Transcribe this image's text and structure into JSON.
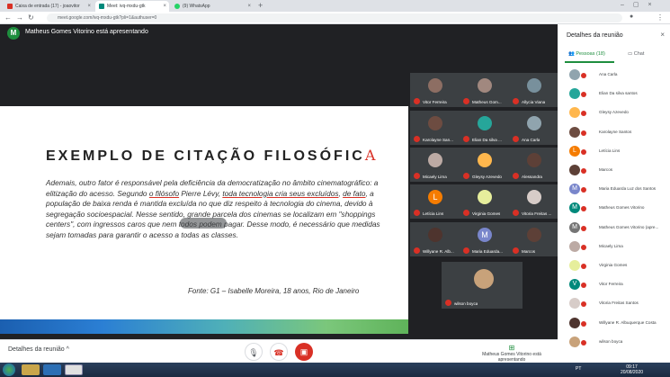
{
  "browser": {
    "tabs": [
      {
        "label": "Caixa de entrada (17) - joaovitor",
        "color": "#d93025"
      },
      {
        "label": "Meet: ivq-mxdu-gtk",
        "color": "#00897b",
        "active": true
      },
      {
        "label": "(9) WhatsApp",
        "color": "#25d366"
      }
    ],
    "url": "meet.google.com/ivq-mxdu-gtk?pli=1&authuser=0"
  },
  "presenter_banner": {
    "avatar": "M",
    "text": "Matheus Gomes Vitorino está apresentando"
  },
  "slide": {
    "title": "EXEMPLO DE CITAÇÃO FILOSÓFIC",
    "title_mark": "A",
    "body_1": "Ademais, outro fator é responsável pela deficiência da democratização no âmbito cinematográfico: a elitização do acesso. Segundo ",
    "body_ul1": "o filósofo",
    "body_2": " Pierre Lévy, ",
    "body_ul2": "toda tecnologia cria seus excluídos",
    "body_3": ", ",
    "body_ul3": "de fato",
    "body_4": ", a população de baixa renda é mantida excluída no que diz respeito à tecnologia do cinema, devido à segregação socioespacial. Nesse sentido, grande parcela dos cinemas se localizam em \"shoppings centers\", com ingressos caros que nem todos podem pagar. Desse modo, é necessário que medidas sejam tomadas para garantir o acesso a todas as classes.",
    "source": "Fonte: G1 – Isabelle Moreira, 18 anos, Rio de Janeiro"
  },
  "tiles": [
    {
      "name": "Vitor Ferreira",
      "color": "#8d6e63"
    },
    {
      "name": "Matheus Gom...",
      "color": "#a1887f"
    },
    {
      "name": "Allycia Viana",
      "color": "#78909c"
    },
    {
      "name": "Karolayne San...",
      "color": "#6d4c41"
    },
    {
      "name": "Elian Da silva ...",
      "color": "#26a69a"
    },
    {
      "name": "Ana Carla",
      "color": "#90a4ae"
    },
    {
      "name": "Micaely Lima",
      "color": "#bcaaa4"
    },
    {
      "name": "Gleysy Azevedo",
      "color": "#ffb74d"
    },
    {
      "name": "Alessandra",
      "color": "#5d4037"
    },
    {
      "name": "Letícia Lins",
      "color": "#f57c00",
      "letter": "L"
    },
    {
      "name": "Virginia Gomes",
      "color": "#e6ee9c"
    },
    {
      "name": "Vitoria Freitas ...",
      "color": "#d7ccc8"
    },
    {
      "name": "Willyane R. Alb...",
      "color": "#4e342e"
    },
    {
      "name": "Maria Eduarda...",
      "color": "#7986cb",
      "letter": "M"
    },
    {
      "name": "Marcos",
      "color": "#5d4037"
    },
    {
      "name": "wilson boyca",
      "color": "#c8a27a"
    }
  ],
  "bottom": {
    "details_label": "Detalhes da reunião",
    "chevron": "^",
    "present_info": "Matheus Gomes Vitorino está apresentando"
  },
  "sidepanel": {
    "title": "Detalhes da reunião",
    "close": "×",
    "tab_people": "Pessoas (18)",
    "tab_chat": "Chat",
    "people": [
      {
        "name": "Ana Carla",
        "color": "#90a4ae"
      },
      {
        "name": "Elian Da silva santos",
        "color": "#26a69a"
      },
      {
        "name": "Gleysy Azevedo",
        "color": "#ffb74d"
      },
      {
        "name": "Karolayne Santos",
        "color": "#6d4c41"
      },
      {
        "name": "Letícia Lins",
        "color": "#f57c00",
        "letter": "L"
      },
      {
        "name": "Marcos",
        "color": "#5d4037"
      },
      {
        "name": "Maria Eduarda Luz dos Santos",
        "color": "#7986cb",
        "letter": "M"
      },
      {
        "name": "Matheus Gomes Vitorino",
        "color": "#00897b",
        "letter": "M"
      },
      {
        "name": "Matheus Gomes Vitorino (apre...",
        "color": "#757575",
        "letter": "M"
      },
      {
        "name": "Micaely Lima",
        "color": "#bcaaa4"
      },
      {
        "name": "Virginia Gomes",
        "color": "#e6ee9c"
      },
      {
        "name": "Vitor Ferreira",
        "color": "#00897b",
        "letter": "V"
      },
      {
        "name": "Vitoria Freitas Santos",
        "color": "#d7ccc8"
      },
      {
        "name": "Willyane R. Albuquerque Costa",
        "color": "#4e342e"
      },
      {
        "name": "wilson boyca",
        "color": "#c8a27a"
      }
    ]
  },
  "taskbar": {
    "lang": "PT",
    "time": "09:17",
    "date": "20/08/2020"
  }
}
